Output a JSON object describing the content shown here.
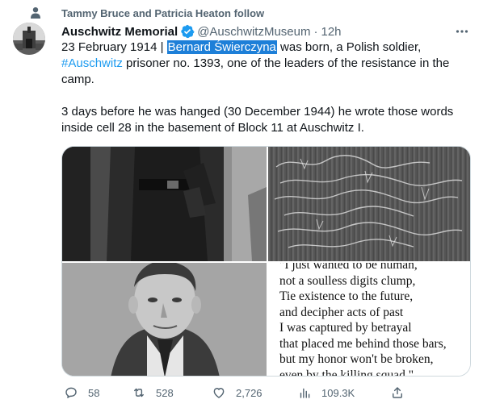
{
  "social_context": "Tammy Bruce and Patricia Heaton follow",
  "author": {
    "name": "Auschwitz Memorial",
    "handle": "@AuschwitzMuseum",
    "separator": "·",
    "time": "12h"
  },
  "more_icon": "more-horizontal-icon",
  "tweet": {
    "line1_prefix": "23 February 1914 | ",
    "highlighted": "Bernard Świerczyna",
    "line1_suffix": " was born, a Polish soldier, ",
    "hashtag": "#Auschwitz",
    "line1_rest": " prisoner no. 1393, one of the leaders of the resistance in the camp.",
    "paragraph2": "3 days before he was hanged (30 December 1944) he wrote those words inside cell 28 in the basement of Block 11 at Auschwitz I."
  },
  "media": {
    "poem_lines": [
      "\"I just wanted to be human,",
      "not a soulless digits clump,",
      "Tie existence to the future,",
      "and decipher acts of past",
      "I was captured by betrayal",
      "that placed me behind those bars,",
      "but my honor won't be broken,",
      "even by the killing squad.\""
    ]
  },
  "actions": {
    "replies": "58",
    "retweets": "528",
    "likes": "2,726",
    "views": "109.3K"
  },
  "colors": {
    "accent": "#1d9bf0",
    "selection": "#1d7fd8",
    "secondary_text": "#536471",
    "verified": "#1d9bf0"
  }
}
